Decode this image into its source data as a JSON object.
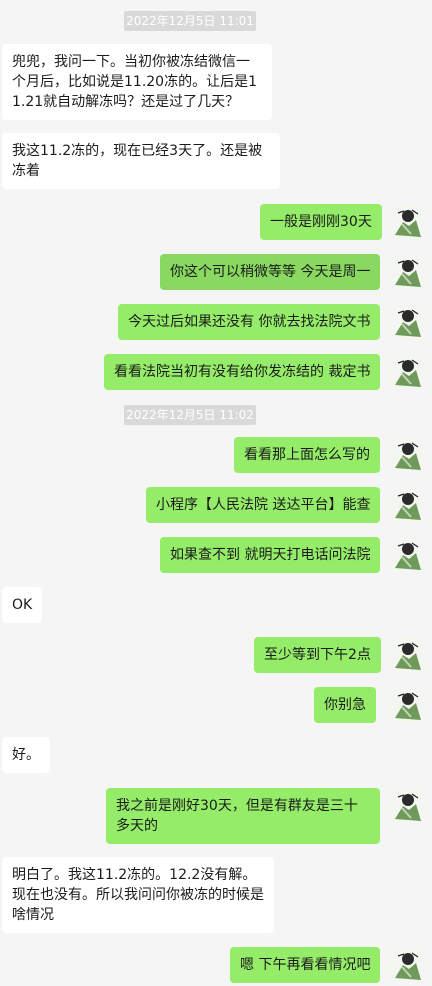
{
  "timestamps": [
    "2022年12月5日 11:01",
    "2022年12月5日 11:02"
  ],
  "messages": [
    {
      "side": "left",
      "text": "兜兜，我问一下。当初你被冻结微信一个月后，比如说是11.20冻的。让后是11.21就自动解冻吗？还是过了几天？"
    },
    {
      "side": "left",
      "text": "我这11.2冻的，现在已经3天了。还是被冻着"
    },
    {
      "side": "right",
      "text": "一般是刚刚30天"
    },
    {
      "side": "right",
      "text": "你这个可以稍微等等 今天是周一"
    },
    {
      "side": "right",
      "text": "今天过后如果还没有 你就去找法院文书"
    },
    {
      "side": "right",
      "text": "看看法院当初有没有给你发冻结的 裁定书"
    },
    {
      "side": "right",
      "text": "看看那上面怎么写的"
    },
    {
      "side": "right",
      "text": "小程序【人民法院 送达平台】能查"
    },
    {
      "side": "right",
      "text": "如果查不到 就明天打电话问法院"
    },
    {
      "side": "left",
      "text": "OK"
    },
    {
      "side": "right",
      "text": "至少等到下午2点"
    },
    {
      "side": "right",
      "text": "你别急"
    },
    {
      "side": "left",
      "text": "好。"
    },
    {
      "side": "right",
      "text": "我之前是刚好30天，但是有群友是三十多天的"
    },
    {
      "side": "left",
      "text": "明白了。我这11.2冻的。12.2没有解。现在也没有。所以我问问你被冻的时候是啥情况"
    },
    {
      "side": "right",
      "text": "嗯 下午再看看情况吧"
    }
  ],
  "colors": {
    "background": "#f5f5f5",
    "bubble_self": "#95ec69",
    "bubble_other": "#ffffff",
    "timestamp_bg": "#d9d9d9"
  },
  "icons": {
    "avatar": "cartoon-character-avatar"
  }
}
